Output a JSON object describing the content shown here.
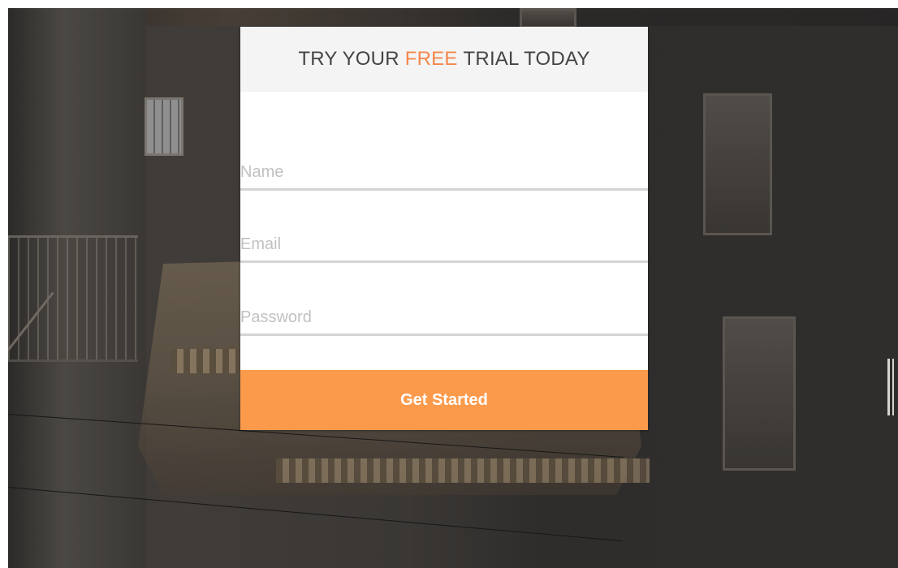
{
  "form": {
    "title_prefix": "TRY YOUR",
    "title_accent": "FREE",
    "title_suffix": "TRIAL TODAY",
    "name_placeholder": "Name",
    "email_placeholder": "Email",
    "password_placeholder": "Password",
    "submit_label": "Get Started"
  },
  "colors": {
    "accent": "#f5874a",
    "button": "#fc9a4c",
    "header_bg": "#f4f4f4",
    "field_border": "#d4d4d4",
    "placeholder": "#c1c1c1"
  }
}
